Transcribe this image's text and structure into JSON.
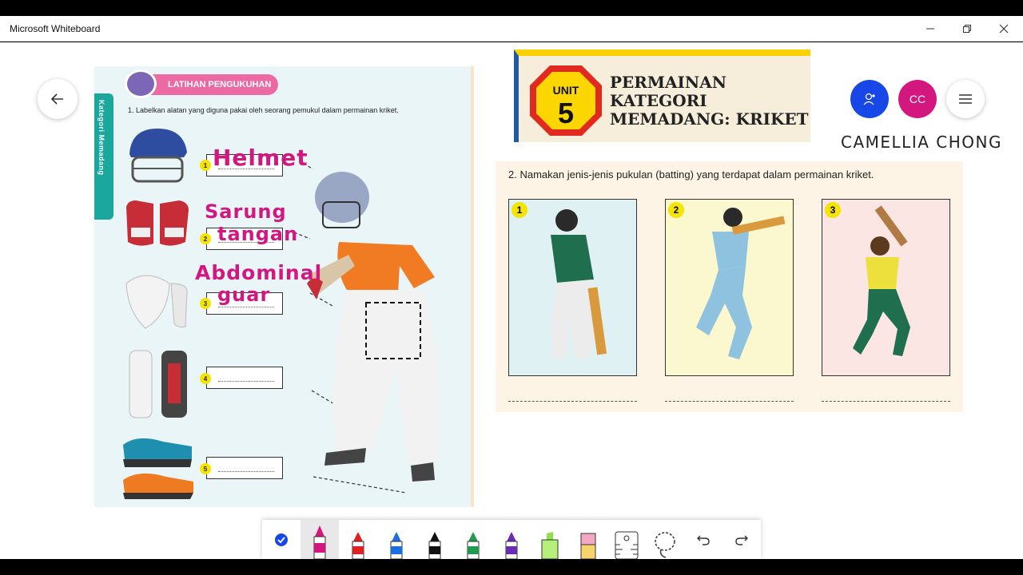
{
  "window": {
    "title": "Microsoft Whiteboard"
  },
  "worksheet": {
    "tab_label": "Kategori Memadang",
    "section_title": "LATIHAN PENGUKUHAN",
    "question1": "1.   Labelkan alatan yang diguna pakai oleh seorang pemukul dalam permainan kriket.",
    "numbers": [
      "1",
      "2",
      "3",
      "4",
      "5"
    ],
    "handwriting": [
      "Helmet",
      "Sarung",
      "tangan",
      "Abdominal",
      "guar"
    ]
  },
  "unit_banner": {
    "unit_label": "UNIT",
    "unit_number": "5",
    "title_lines": [
      "PERMAINAN",
      "KATEGORI",
      "MEMADANG: KRIKET"
    ]
  },
  "collab": {
    "initials": "CC",
    "name": "CAMELLIA CHONG"
  },
  "question2": {
    "text": "2.   Namakan jenis-jenis pukulan (batting) yang terdapat dalam permainan kriket.",
    "panels": [
      {
        "number": "1",
        "bg": "#dff1f3"
      },
      {
        "number": "2",
        "bg": "#fbf7cf"
      },
      {
        "number": "3",
        "bg": "#fbe6e4"
      }
    ]
  },
  "colors": {
    "accent_blue": "#1847e8",
    "accent_pink": "#d4177f",
    "ink_pink": "#d31780"
  },
  "toolbar": {
    "tools": [
      "select-tool",
      "pen-pink",
      "pen-red",
      "pen-blue",
      "pen-black",
      "pen-green",
      "pen-purple",
      "highlighter-green",
      "highlighter-pink",
      "ruler",
      "lasso",
      "undo",
      "redo"
    ]
  }
}
